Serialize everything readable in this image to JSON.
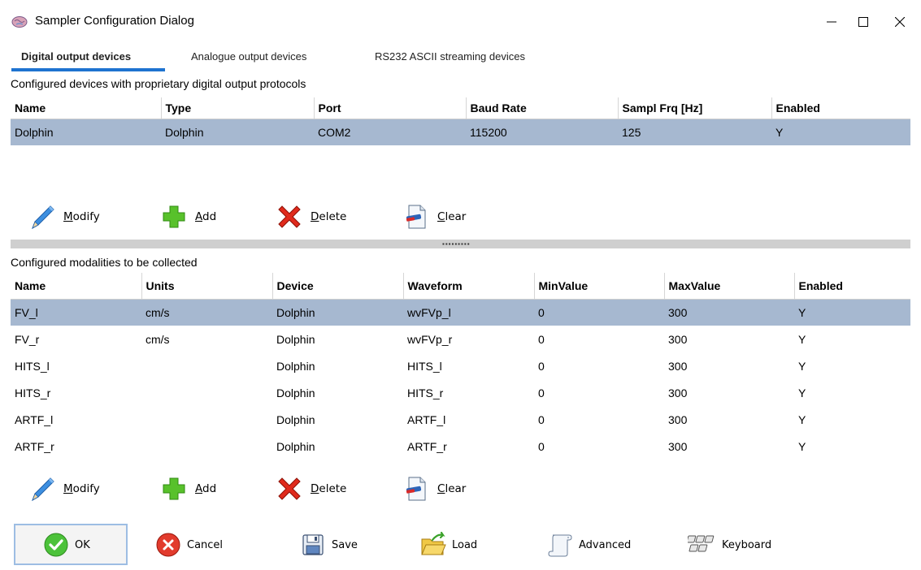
{
  "window": {
    "title": "Sampler Configuration Dialog"
  },
  "tabs": [
    {
      "label": "Digital output devices",
      "active": true
    },
    {
      "label": "Analogue output devices",
      "active": false
    },
    {
      "label": "RS232 ASCII streaming devices",
      "active": false
    }
  ],
  "devices": {
    "caption": "Configured devices with proprietary digital output protocols",
    "columns": [
      "Name",
      "Type",
      "Port",
      "Baud Rate",
      "Sampl Frq [Hz]",
      "Enabled"
    ],
    "rows": [
      [
        "Dolphin",
        "Dolphin",
        "COM2",
        "115200",
        "125",
        "Y"
      ]
    ],
    "selected_row": 0
  },
  "device_toolbar": {
    "modify": {
      "mnemonic": "M",
      "rest": "odify"
    },
    "add": {
      "mnemonic": "A",
      "rest": "dd"
    },
    "delete": {
      "mnemonic": "D",
      "rest": "elete"
    },
    "clear": {
      "mnemonic": "C",
      "rest": "lear"
    }
  },
  "modalities": {
    "caption": "Configured modalities to be collected",
    "columns": [
      "Name",
      "Units",
      "Device",
      "Waveform",
      "MinValue",
      "MaxValue",
      "Enabled"
    ],
    "rows": [
      [
        "FV_l",
        "cm/s",
        "Dolphin",
        "wvFVp_l",
        "0",
        "300",
        "Y"
      ],
      [
        "FV_r",
        "cm/s",
        "Dolphin",
        "wvFVp_r",
        "0",
        "300",
        "Y"
      ],
      [
        "HITS_l",
        "",
        "Dolphin",
        "HITS_l",
        "0",
        "300",
        "Y"
      ],
      [
        "HITS_r",
        "",
        "Dolphin",
        "HITS_r",
        "0",
        "300",
        "Y"
      ],
      [
        "ARTF_l",
        "",
        "Dolphin",
        "ARTF_l",
        "0",
        "300",
        "Y"
      ],
      [
        "ARTF_r",
        "",
        "Dolphin",
        "ARTF_r",
        "0",
        "300",
        "Y"
      ]
    ],
    "selected_row": 0
  },
  "modality_toolbar": {
    "modify": {
      "mnemonic": "M",
      "rest": "odify"
    },
    "add": {
      "mnemonic": "A",
      "rest": "dd"
    },
    "delete": {
      "mnemonic": "D",
      "rest": "elete"
    },
    "clear": {
      "mnemonic": "C",
      "rest": "lear"
    }
  },
  "footer": {
    "ok": "OK",
    "cancel": "Cancel",
    "save": "Save",
    "load": "Load",
    "advanced": "Advanced",
    "keyboard": "Keyboard"
  },
  "colors": {
    "selection": "#a6b8d0",
    "tab_underline": "#1e73d0",
    "ok_border": "#9dbde3"
  }
}
